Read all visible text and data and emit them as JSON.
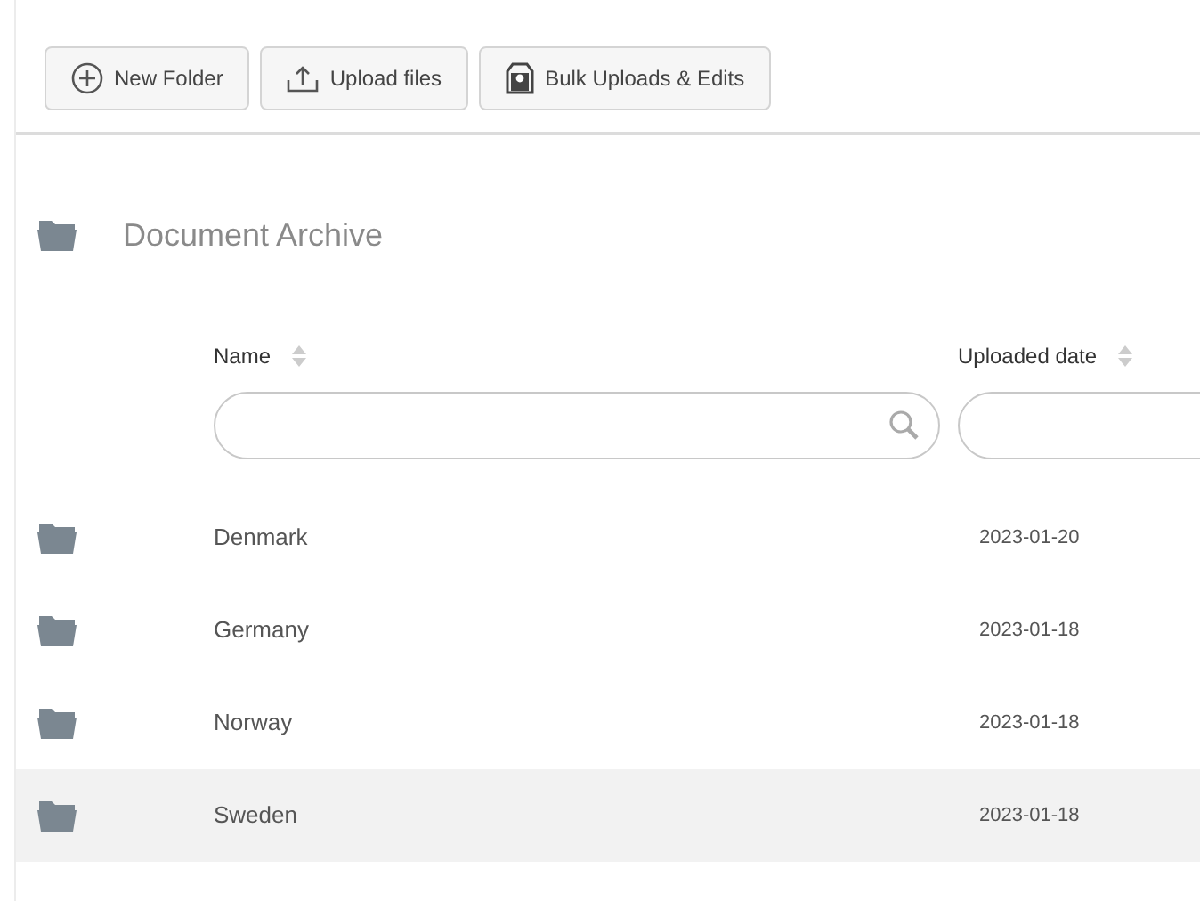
{
  "toolbar": {
    "buttons": [
      {
        "kind": "new-folder",
        "label": "New Folder"
      },
      {
        "kind": "upload",
        "label": "Upload files"
      },
      {
        "kind": "bulk",
        "label": "Bulk Uploads & Edits"
      }
    ]
  },
  "folder": {
    "title": "Document Archive"
  },
  "table": {
    "columns": [
      {
        "label": "Name",
        "kind": "search"
      },
      {
        "label": "Uploaded date",
        "kind": "plain"
      }
    ],
    "rows": [
      {
        "name": "Denmark",
        "date": "2023-01-20",
        "selected": false
      },
      {
        "name": "Germany",
        "date": "2023-01-18",
        "selected": false
      },
      {
        "name": "Norway",
        "date": "2023-01-18",
        "selected": false
      },
      {
        "name": "Sweden",
        "date": "2023-01-18",
        "selected": true
      }
    ]
  }
}
